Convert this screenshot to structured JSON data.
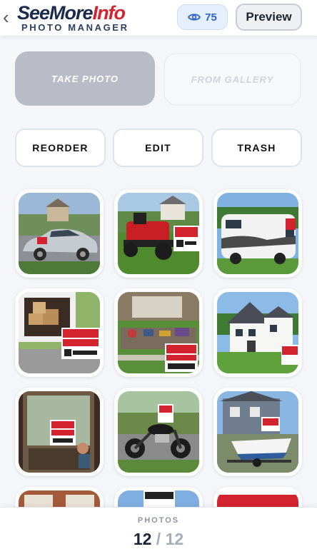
{
  "header": {
    "logo_main_a": "SeeMore",
    "logo_main_b": "Info",
    "logo_sub": "PHOTO MANAGER",
    "views_count": "75",
    "preview_label": "Preview",
    "back_icon": "chevron-left-icon",
    "views_icon": "eye-icon"
  },
  "source": {
    "take_photo_label": "TAKE PHOTO",
    "from_gallery_label": "FROM GALLERY"
  },
  "actions": {
    "reorder_label": "REORDER",
    "edit_label": "EDIT",
    "trash_label": "TRASH"
  },
  "photos": [
    {
      "subject": "silver sedan",
      "sign": "FOR SALE"
    },
    {
      "subject": "red riding lawn mower",
      "sign": "Lawn Mower"
    },
    {
      "subject": "motorhome",
      "sign": "FOR SALE"
    },
    {
      "subject": "moving van",
      "sign": "WE'RE MOVING",
      "sign_url": "SeeMoreInfo.com",
      "sign_code": "#12345"
    },
    {
      "subject": "yard sale items",
      "sign": "YARD SALE",
      "sign_url": "SeeMoreInfo.com",
      "sign_code": "#12345"
    },
    {
      "subject": "white house",
      "sign": "OPEN HOUSE"
    },
    {
      "subject": "cafe window",
      "sign": "HELP WANTED",
      "sign_url": "SeeMoreInfo.com",
      "sign_code": "#12345"
    },
    {
      "subject": "motorcycle",
      "sign": "FOR SALE"
    },
    {
      "subject": "boat on trailer",
      "sign": "FOR SALE"
    },
    {
      "subject": "house partially visible",
      "sign": ""
    },
    {
      "subject": "lost dog sign",
      "sign": "LOST DOG"
    },
    {
      "subject": "for sale sign",
      "sign": "FOR SALE"
    }
  ],
  "footer": {
    "label": "PHOTOS",
    "current": "12",
    "separator": "/",
    "total": "12"
  },
  "colors": {
    "brand_navy": "#1b2a4a",
    "brand_red": "#d3232e",
    "accent_blue": "#2f63c8"
  }
}
